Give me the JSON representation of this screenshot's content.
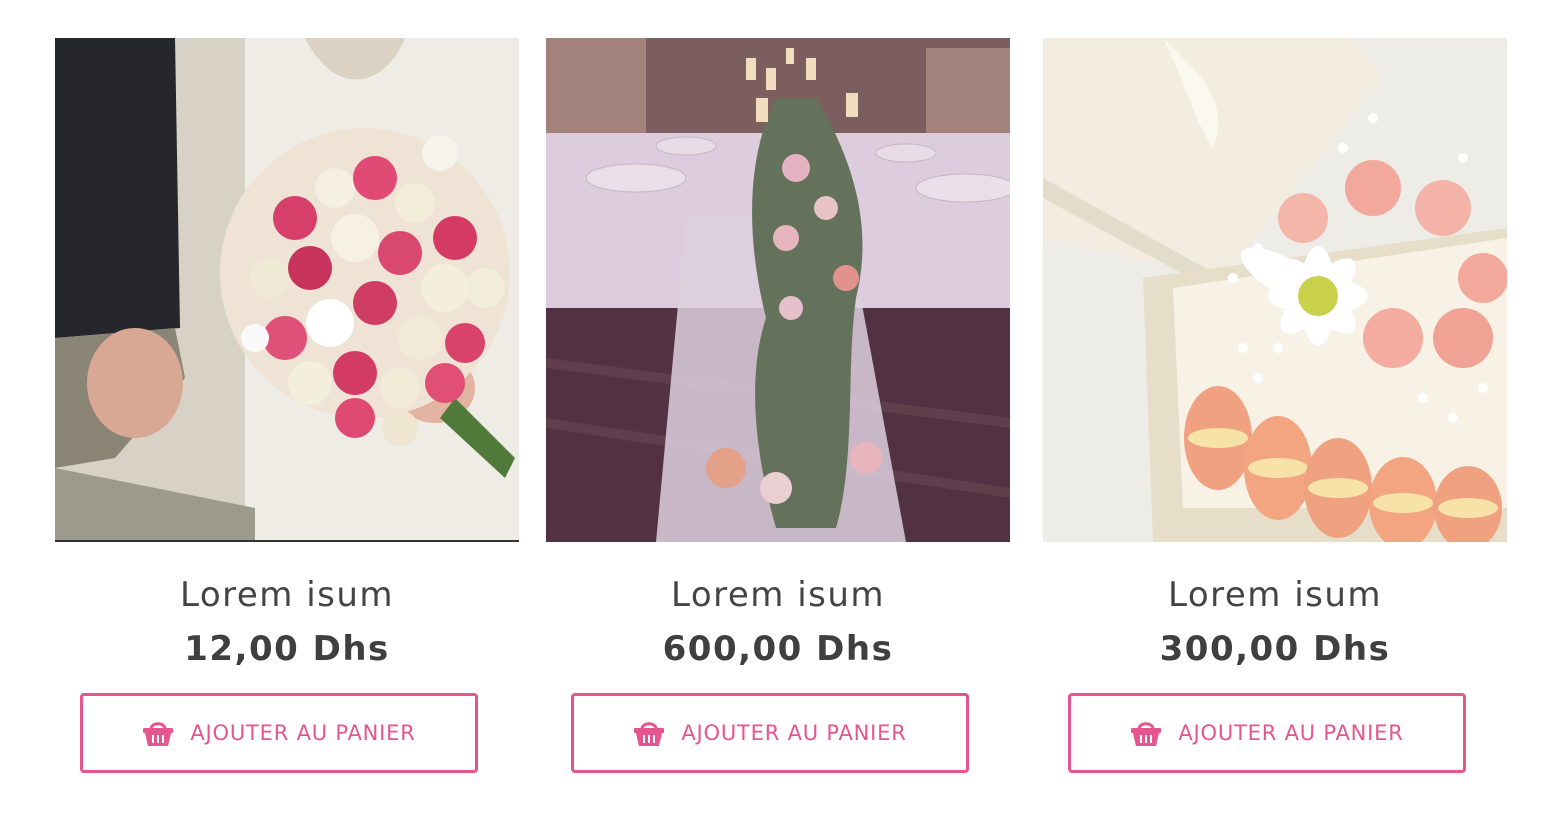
{
  "products": [
    {
      "name": "Lorem isum",
      "price": "12,00 Dhs",
      "button_label": "AJOUTER AU PANIER",
      "image": "bridal-bouquet-photo"
    },
    {
      "name": "Lorem isum",
      "price": "600,00 Dhs",
      "button_label": "AJOUTER AU PANIER",
      "image": "wedding-table-photo"
    },
    {
      "name": "Lorem isum",
      "price": "300,00 Dhs",
      "button_label": "AJOUTER AU PANIER",
      "image": "flower-macaron-box-photo"
    }
  ],
  "colors": {
    "accent": "#e5558f",
    "text": "#444444",
    "price": "#3f3f3f"
  },
  "icons": {
    "cart": "basket-icon"
  }
}
